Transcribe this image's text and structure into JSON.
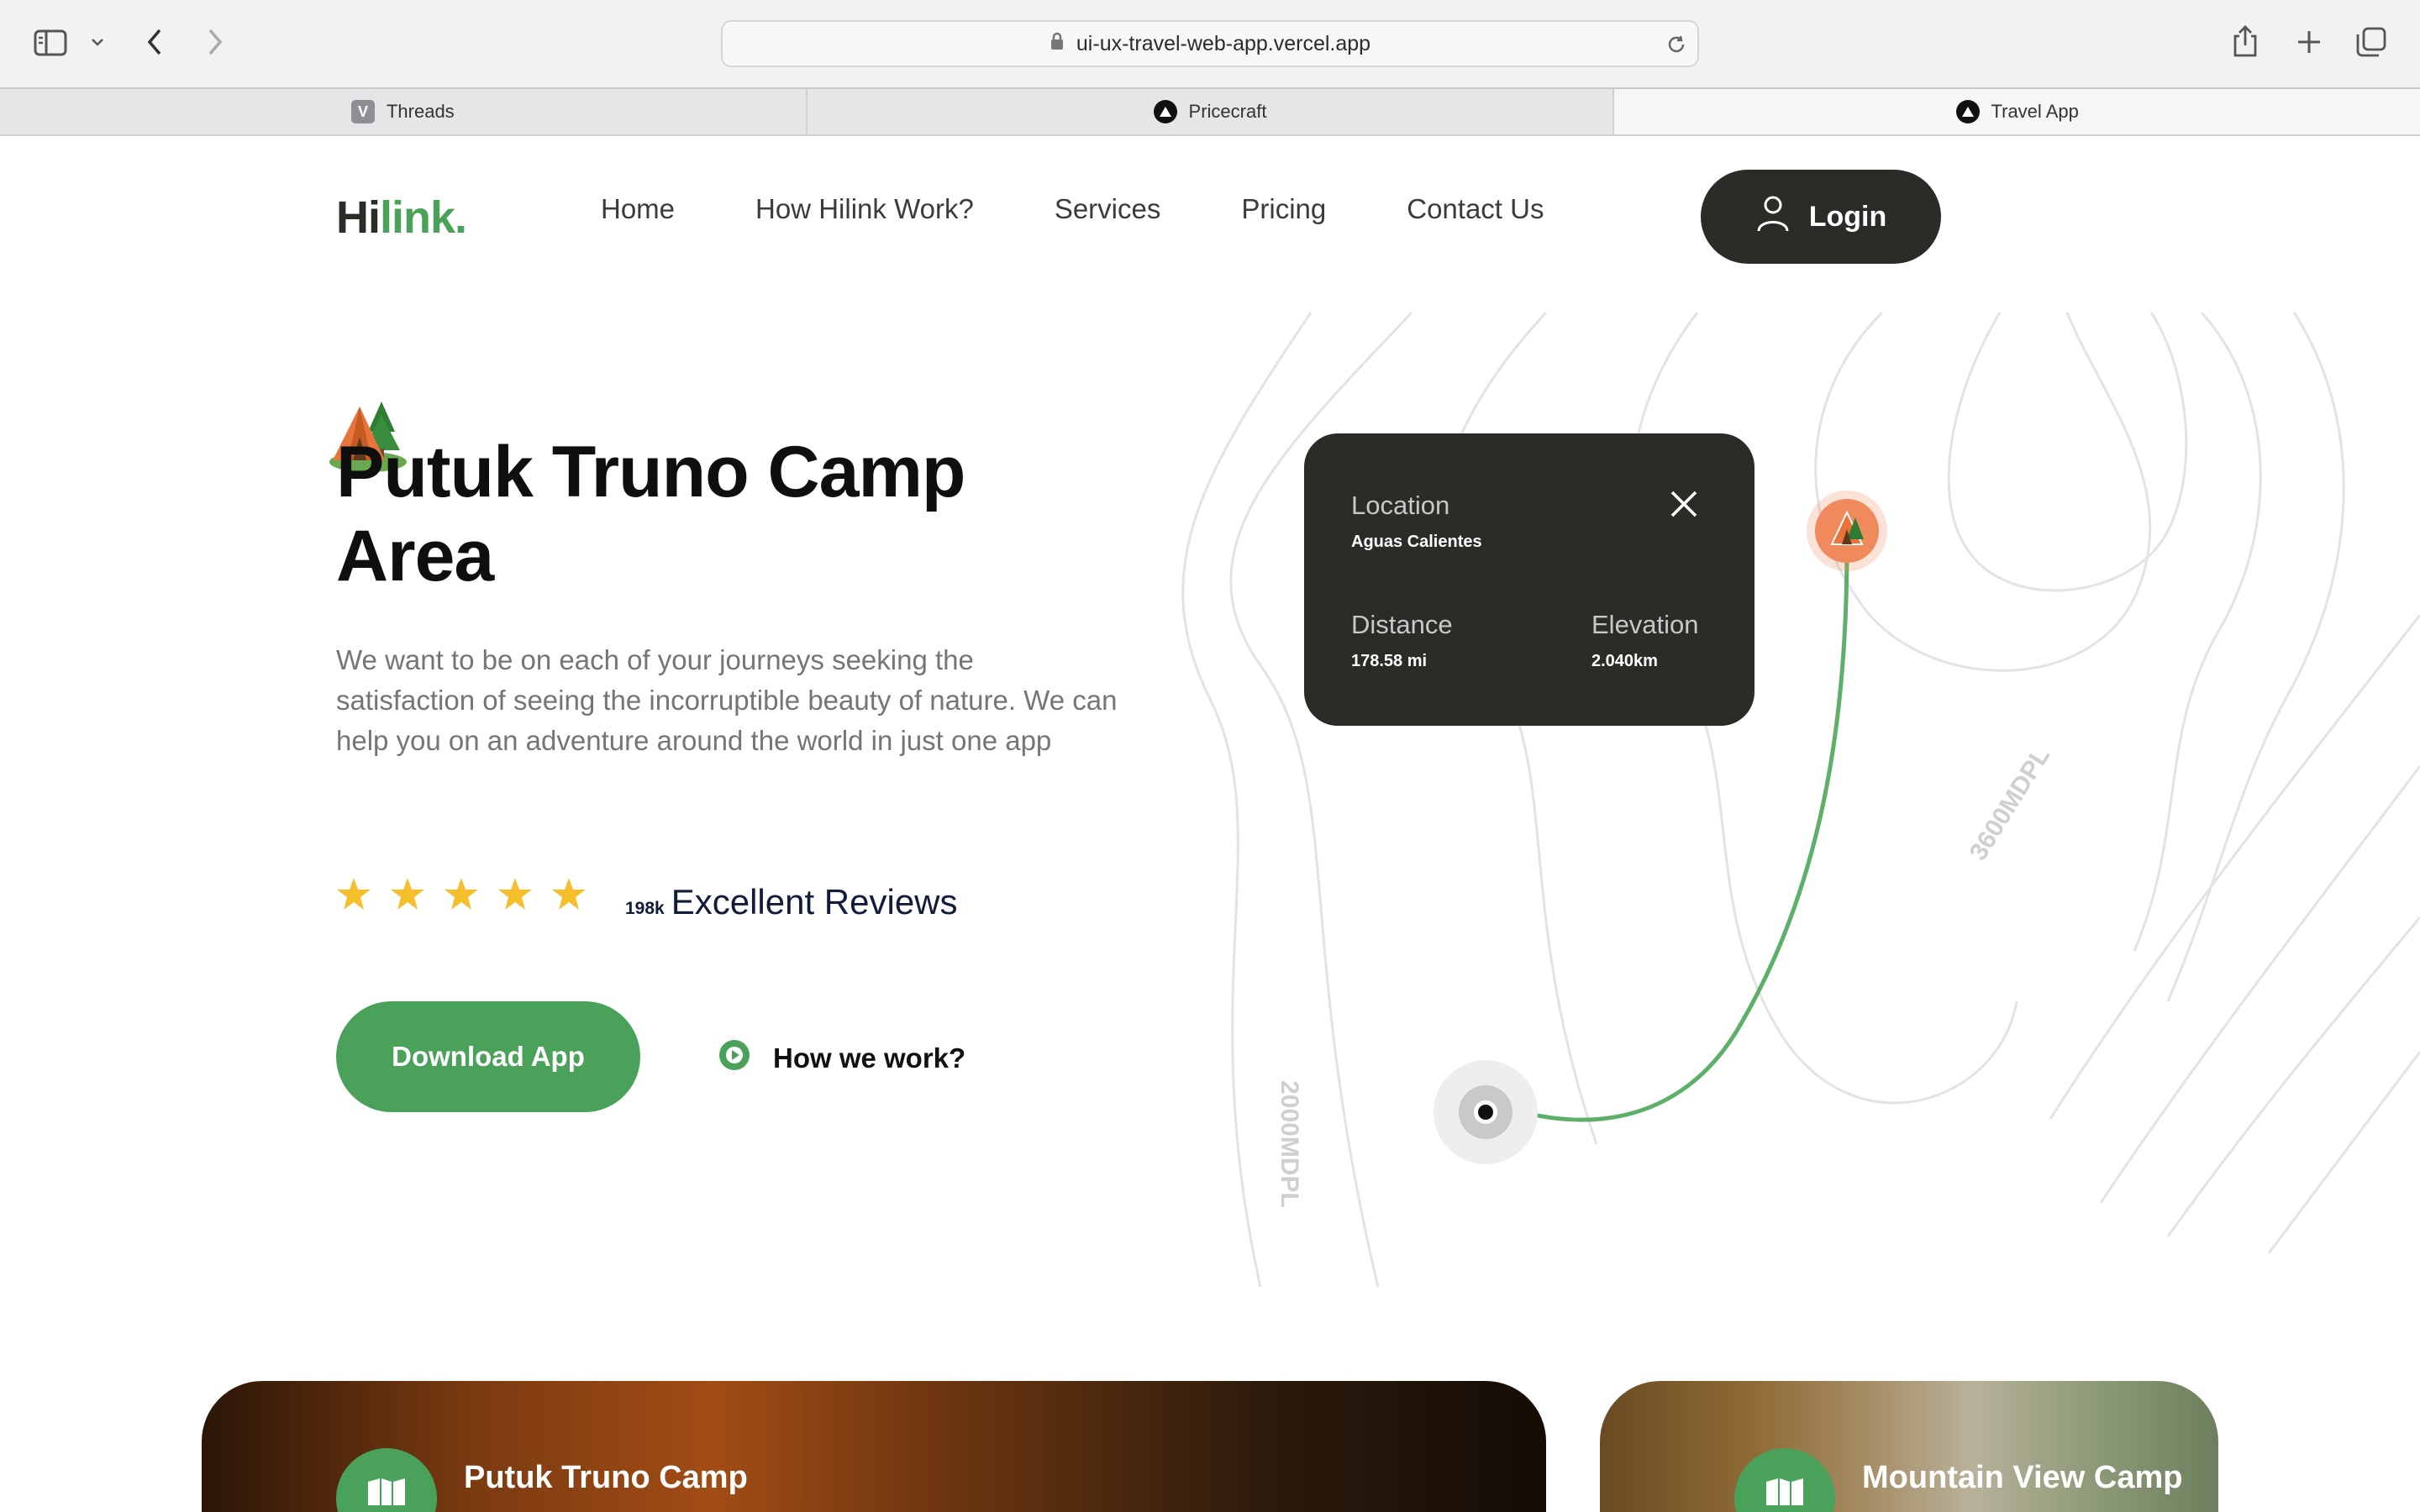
{
  "browser": {
    "url": "ui-ux-travel-web-app.vercel.app",
    "tabs": [
      {
        "label": "Threads",
        "favicon": "V"
      },
      {
        "label": "Pricecraft"
      },
      {
        "label": "Travel App"
      }
    ]
  },
  "header": {
    "logo_part1": "Hi",
    "logo_part2": "link.",
    "nav": [
      "Home",
      "How Hilink Work?",
      "Services",
      "Pricing",
      "Contact Us"
    ],
    "login_label": "Login"
  },
  "hero": {
    "title": "Putuk Truno Camp Area",
    "description": "We want to be on each of your journeys seeking the satisfaction of seeing the incorruptible beauty of nature. We can help you on an adventure around the world in just one app",
    "rating_stars": 5,
    "reviews_count": "198k",
    "reviews_label": "Excellent Reviews",
    "download_label": "Download App",
    "how_label": "How we work?"
  },
  "map": {
    "location_label": "Location",
    "location_value": "Aguas Calientes",
    "distance_label": "Distance",
    "distance_value": "178.58 mi",
    "elevation_label": "Elevation",
    "elevation_value": "2.040km",
    "contour_label_1": "2000MDPL",
    "contour_label_2": "3600MDPL"
  },
  "cards": [
    {
      "title": "Putuk Truno Camp"
    },
    {
      "title": "Mountain View Camp"
    }
  ],
  "colors": {
    "brand_green": "#4aa25a",
    "dark": "#292c27",
    "star": "#f5bf2b",
    "pin": "#f08a5d"
  }
}
